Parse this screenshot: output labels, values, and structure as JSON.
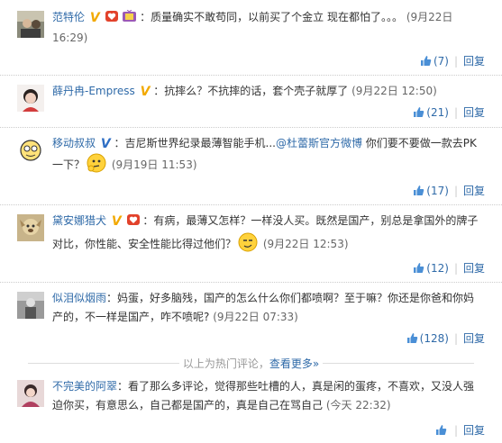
{
  "comments": [
    {
      "user": "范特伦",
      "text": "：质量确实不敢苟同，以前买了个金立 现在都怕了。。。",
      "time": "(9月22日 16:29)",
      "like_count": "(7)",
      "reply_label": "回复"
    },
    {
      "user": "薛丹冉-Empress",
      "text": "：抗摔么？不抗摔的话，套个壳子就厚了",
      "time": "(9月22日 12:50)",
      "like_count": "(21)",
      "reply_label": "回复"
    },
    {
      "user": "移动叔叔",
      "text": "：吉尼斯世界纪录最薄智能手机...",
      "mention": "@杜蕾斯官方微博",
      "text2": " 你们要不要做一款去PK一下？",
      "time": "(9月19日 11:53)",
      "like_count": "(17)",
      "reply_label": "回复"
    },
    {
      "user": "黛安娜猎犬",
      "text": "：有病，最薄又怎样？一样没人买。既然是国产，别总是拿国外的牌子对比，你性能、安全性能比得过他们？",
      "time": "(9月22日 12:53)",
      "like_count": "(12)",
      "reply_label": "回复"
    },
    {
      "user": "似泪似烟雨",
      "text": "：妈蛋，好多脑残，国产的怎么什么你们都喷啊？至于嘛？你还是你爸和你妈产的，不一样是国产，咋不喷呢?",
      "time": "(9月22日 07:33)",
      "like_count": "(128)",
      "reply_label": "回复"
    },
    {
      "user": "不完美的阿翠",
      "text": "：看了那么多评论，觉得那些吐槽的人，真是闲的蛋疼，不喜欢，又没人强迫你买，有意思么，自己都是国产的，真是自己在骂自己",
      "time": "(今天 22:32)",
      "reply_label": "回复"
    }
  ],
  "hot_divider": {
    "text": "以上为热门评论，",
    "more_link": "查看更多»"
  },
  "colors": {
    "link": "#2f6aa8",
    "text": "#333333",
    "muted": "#999999",
    "verified_yellow": "#f2a900",
    "verified_blue": "#2e6ec4"
  }
}
